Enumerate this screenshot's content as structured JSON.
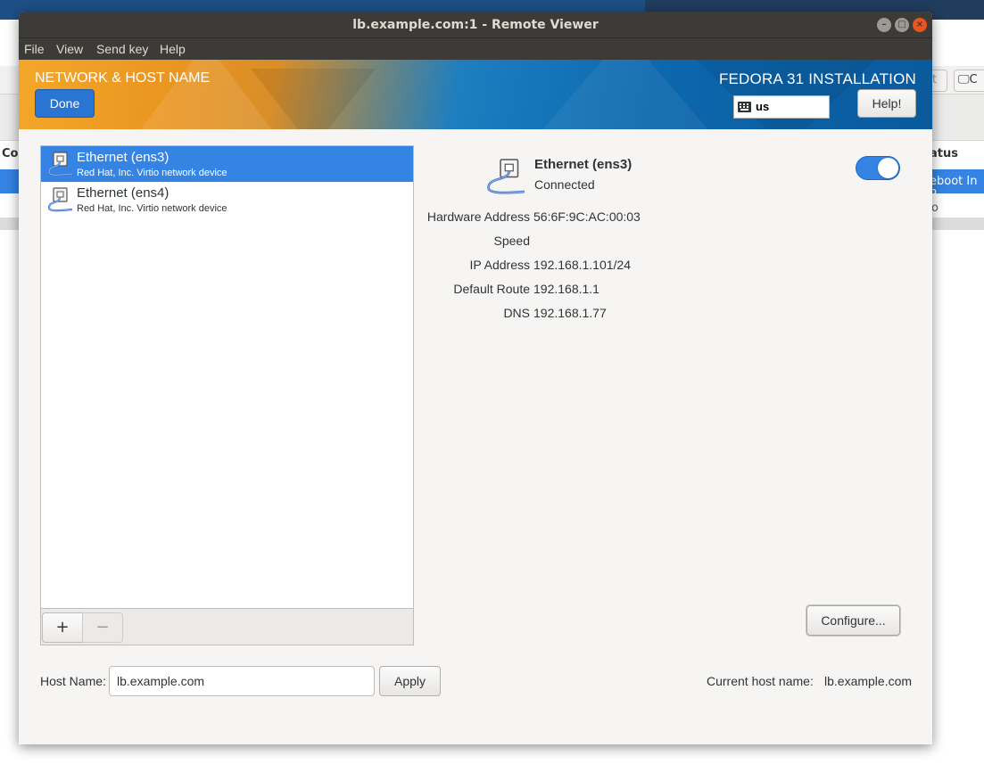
{
  "background_app": {
    "toolbar_buttons": [
      "ot",
      "C"
    ],
    "column_header_left": "Co",
    "column_header_right": "atus",
    "selected_row_text": "eboot In P",
    "row2_text": "o"
  },
  "window": {
    "title": "lb.example.com:1 - Remote Viewer",
    "controls": {
      "minimize": "–",
      "maximize": "□",
      "close": "×"
    }
  },
  "menubar": {
    "items": [
      "File",
      "View",
      "Send key",
      "Help"
    ]
  },
  "header": {
    "spoke_title": "NETWORK & HOST NAME",
    "done_label": "Done",
    "product_title": "FEDORA 31 INSTALLATION",
    "keyboard_layout": "us",
    "help_label": "Help!"
  },
  "devices": [
    {
      "name": "Ethernet (ens3)",
      "description": "Red Hat, Inc. Virtio network device",
      "selected": true
    },
    {
      "name": "Ethernet (ens4)",
      "description": "Red Hat, Inc. Virtio network device",
      "selected": false
    }
  ],
  "list_toolbar": {
    "add": "+",
    "remove": "−"
  },
  "details": {
    "name": "Ethernet (ens3)",
    "status": "Connected",
    "enabled": true,
    "properties": [
      {
        "label": "Hardware Address",
        "value": "56:6F:9C:AC:00:03"
      },
      {
        "label": "Speed",
        "value": ""
      },
      {
        "label": "IP Address",
        "value": "192.168.1.101/24"
      },
      {
        "label": "Default Route",
        "value": "192.168.1.1"
      },
      {
        "label": "DNS",
        "value": "192.168.1.77"
      }
    ],
    "configure_label": "Configure..."
  },
  "hostname": {
    "label": "Host Name:",
    "value": "lb.example.com",
    "apply_label": "Apply",
    "current_label": "Current host name:",
    "current_value": "lb.example.com"
  },
  "colors": {
    "accent": "#3584e4",
    "titlebar": "#3c3b37",
    "close_button": "#e9541f"
  }
}
